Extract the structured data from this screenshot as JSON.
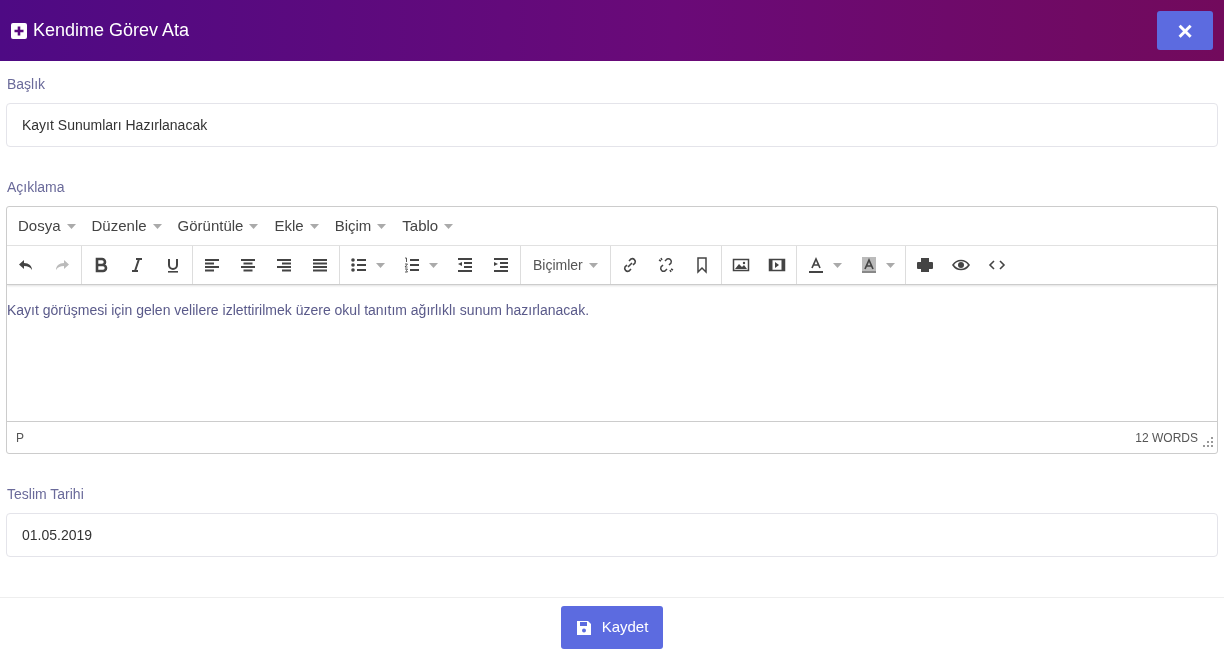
{
  "modal": {
    "title": "Kendime Görev Ata",
    "close": "×"
  },
  "fields": [
    {
      "label": "Başlık",
      "value": "Kayıt Sunumları Hazırlanacak"
    }
  ],
  "description": {
    "label": "Açıklama",
    "menu": [
      "Dosya",
      "Düzenle",
      "Görüntüle",
      "Ekle",
      "Biçim",
      "Tablo"
    ],
    "toolbar": {
      "undo": {
        "disabled": false
      },
      "redo": {
        "disabled": true
      },
      "formats": "Biçimler"
    },
    "content": "Kayıt görüşmesi için gelen velilere izlettirilmek üzere okul tanıtım ağırlıklı sunum hazırlanacak.",
    "path": "P",
    "word_count": "12 WORDS"
  },
  "due_date": {
    "label": "Teslim Tarihi",
    "value": "01.05.2019"
  },
  "save_button": "Kaydet"
}
